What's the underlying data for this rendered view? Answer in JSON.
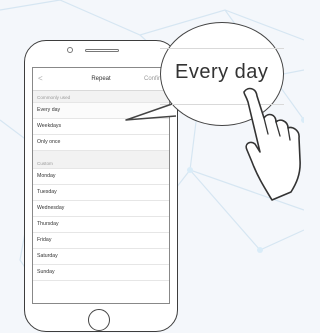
{
  "navbar": {
    "back_symbol": "<",
    "title": "Repeat",
    "confirm": "Confirm"
  },
  "sections": {
    "commonly_used": {
      "header": "Commonly used",
      "items": [
        {
          "label": "Every day",
          "selected": true
        },
        {
          "label": "Weekdays",
          "selected": false
        },
        {
          "label": "Only once",
          "selected": false
        }
      ]
    },
    "custom": {
      "header": "Custom",
      "items": [
        {
          "label": "Monday"
        },
        {
          "label": "Tuesday"
        },
        {
          "label": "Wednesday"
        },
        {
          "label": "Thursday"
        },
        {
          "label": "Friday"
        },
        {
          "label": "Saturday"
        },
        {
          "label": "Sunday"
        }
      ]
    }
  },
  "callout": {
    "label": "Every day"
  },
  "colors": {
    "accent": "#3aa0ff",
    "net": "#cfe3f2",
    "node": "#d9ecf8"
  },
  "icons": [
    "check-icon",
    "hand-pointer-icon"
  ]
}
